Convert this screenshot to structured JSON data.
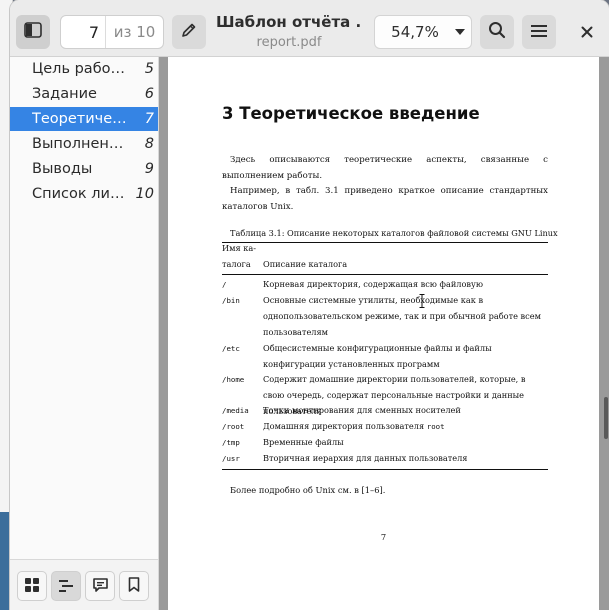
{
  "toolbar": {
    "current_page": "7",
    "total_pages": "из 10",
    "doc_title": "Шаблон отчёта ...",
    "file_name": "report.pdf",
    "zoom": "54,7%"
  },
  "sidebar": {
    "items": [
      {
        "label": "Цель работы",
        "page": "5"
      },
      {
        "label": "Задание",
        "page": "6"
      },
      {
        "label": "Теоретичес…",
        "page": "7"
      },
      {
        "label": "Выполнение…",
        "page": "8"
      },
      {
        "label": "Выводы",
        "page": "9"
      },
      {
        "label": "Список лите…",
        "page": "10"
      }
    ],
    "selected_index": 2
  },
  "document": {
    "section_title": "3  Теоретическое введение",
    "para1": "Здесь описываются теоретические аспекты, связанные с выполнением работы.",
    "para2": "Например, в табл. 3.1 приведено краткое описание стандартных каталогов Unix.",
    "table_caption": "Таблица 3.1: Описание некоторых каталогов файловой системы GNU Linux",
    "table_header": {
      "col1_line1": "Имя ка-",
      "col1_line2": "талога",
      "col2": "Описание каталога"
    },
    "rows": [
      {
        "dir": "/",
        "desc": "Корневая директория, содержащая всю файловую"
      },
      {
        "dir": "/bin",
        "desc": "Основные системные утилиты, необходимые как в однопользовательском режиме, так и при обычной работе всем пользователям"
      },
      {
        "dir": "/etc",
        "desc": "Общесистемные конфигурационные файлы и файлы конфигурации установленных программ"
      },
      {
        "dir": "/home",
        "desc": "Содержит домашние директории пользователей, которые, в свою очередь, содержат персональные настройки и данные пользователя"
      },
      {
        "dir": "/media",
        "desc": "Точки монтирования для сменных носителей"
      },
      {
        "dir": "/root",
        "desc_prefix": "Домашняя директория пользователя ",
        "desc_mono": "root"
      },
      {
        "dir": "/tmp",
        "desc": "Временные файлы"
      },
      {
        "dir": "/usr",
        "desc": "Вторичная иерархия для данных пользователя"
      }
    ],
    "footnote": "Более подробно об Unix см. в [1–6].",
    "page_number": "7"
  },
  "icons": {
    "sidebar_toggle": "sidebar-toggle-icon",
    "annotate": "pencil-icon",
    "search": "search-icon",
    "menu": "hamburger-menu-icon",
    "close": "close-icon",
    "thumbnails": "grid-icon",
    "outline": "outline-list-icon",
    "annotations": "comment-icon",
    "bookmarks": "bookmark-icon"
  },
  "colors": {
    "accent": "#3584e4"
  }
}
